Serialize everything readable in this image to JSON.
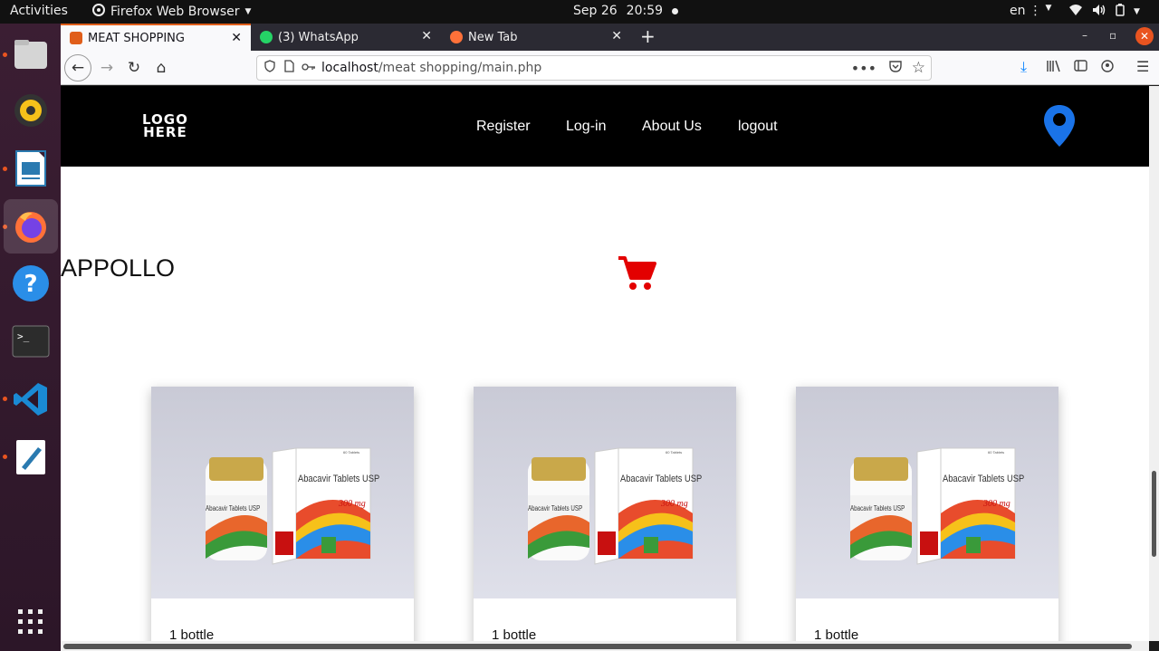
{
  "topbar": {
    "activities": "Activities",
    "app_name": "Firefox Web Browser",
    "date": "Sep 26",
    "time": "20:59",
    "lang": "en"
  },
  "dock": {
    "apps": [
      "files-icon",
      "rhythmbox-icon",
      "writer-icon",
      "firefox-icon",
      "help-icon",
      "terminal-icon",
      "vscode-icon",
      "text-editor-icon",
      "app-grid-icon"
    ]
  },
  "browser": {
    "tabs": [
      {
        "label": "MEAT SHOPPING"
      },
      {
        "label": "(3) WhatsApp"
      },
      {
        "label": "New Tab"
      }
    ],
    "url_host": "localhost",
    "url_path": "/meat shopping/main.php"
  },
  "site": {
    "logo_line1": "LOGO",
    "logo_line2": "HERE",
    "nav": [
      "Register",
      "Log-in",
      "About Us",
      "logout"
    ],
    "brand": "APPOLLO",
    "accent": "#e30000",
    "pin_color": "#1a73e8",
    "products": [
      {
        "title": "1 bottle",
        "box_label": "Abacavir Tablets USP",
        "dose": "300 mg",
        "count": "60 Tablets"
      },
      {
        "title": "1 bottle",
        "box_label": "Abacavir Tablets USP",
        "dose": "300 mg",
        "count": "60 Tablets"
      },
      {
        "title": "1 bottle",
        "box_label": "Abacavir Tablets USP",
        "dose": "300 mg",
        "count": "60 Tablets"
      }
    ]
  }
}
